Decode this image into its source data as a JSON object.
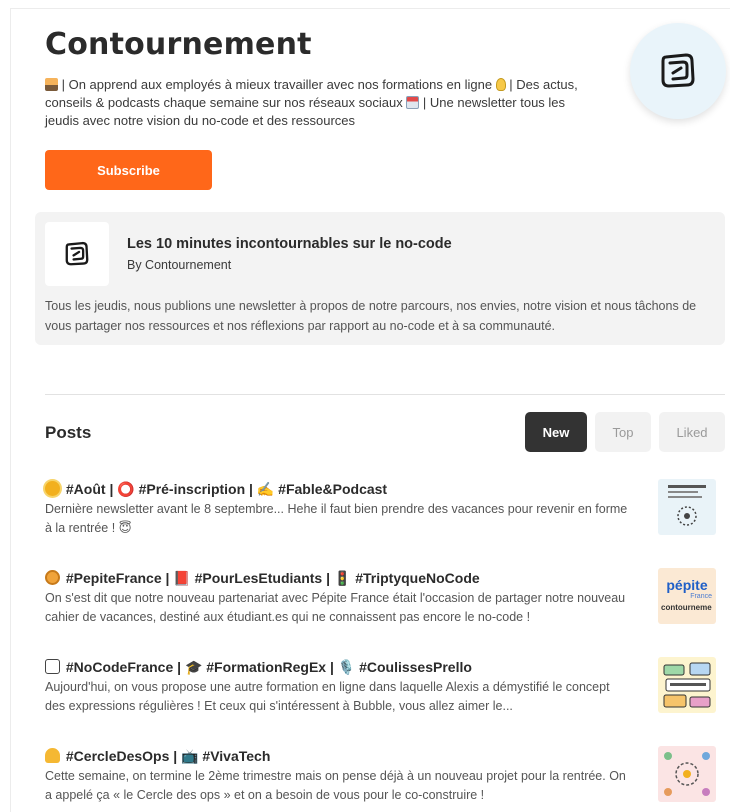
{
  "publication": {
    "title": "Contournement",
    "description": {
      "part1": " | On apprend aux employés à mieux travailler avec nos formations en ligne ",
      "part2": " | Des actus, conseils & podcasts chaque semaine sur nos réseaux sociaux ",
      "part3": " | Une newsletter tous les jeudis avec notre vision du no-code et des ressources"
    },
    "subscribe_label": "Subscribe"
  },
  "newsletter": {
    "title": "Les 10 minutes incontournables sur le no-code",
    "author": "By Contournement",
    "description": "Tous les jeudis, nous publions une newsletter à propos de notre parcours, nos envies, notre vision et nous tâchons de vous partager nos ressources et nos réflexions par rapport au no-code et à sa communauté."
  },
  "posts": {
    "heading": "Posts",
    "tabs": [
      {
        "label": "New",
        "active": true
      },
      {
        "label": "Top",
        "active": false
      },
      {
        "label": "Liked",
        "active": false
      }
    ],
    "items": [
      {
        "title": "#Août | ⭕ #Pré-inscription | ✍️ #Fable&Podcast",
        "subtitle": "Dernière newsletter avant le 8 septembre... Hehe il faut bien prendre des vacances pour revenir en forme à la rentrée ! 😇"
      },
      {
        "title": "#PepiteFrance | 📕 #PourLesEtudiants | 🚦 #TriptyqueNoCode",
        "subtitle": "On s'est dit que notre nouveau partenariat avec Pépite France était l'occasion de partager notre nouveau cahier de vacances, destiné aux étudiant.es qui ne connaissent pas encore le no-code !",
        "thumb_brand": "pépite",
        "thumb_brand_sub": "France",
        "thumb_brand_foot": "contourneme"
      },
      {
        "title": "#NoCodeFrance | 🎓 #FormationRegEx | 🎙️ #CoulissesPrello",
        "subtitle": "Aujourd'hui, on vous propose une autre formation en ligne dans laquelle Alexis a démystifié le concept des expressions régulières ! Et ceux qui s'intéressent à Bubble, vous allez aimer le..."
      },
      {
        "title": "#CercleDesOps | 📺 #VivaTech",
        "subtitle": "Cette semaine, on termine le 2ème trimestre mais on pense déjà à un nouveau projet pour la rentrée. On a appelé ça « le Cercle des ops » et on a besoin de vous pour le co-construire !"
      }
    ]
  }
}
